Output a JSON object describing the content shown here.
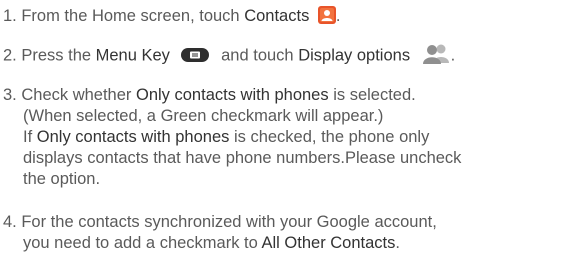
{
  "steps": [
    {
      "num": "1.",
      "pre": " From the Home screen, touch ",
      "bold": "Contacts",
      "post": ".",
      "icon": "contacts-icon"
    },
    {
      "num": "2.",
      "a": " Press the ",
      "b1": "Menu Key",
      "c": " and touch ",
      "b2": "Display options",
      "d": ".",
      "icons": [
        "menu-key-icon",
        "display-options-icon"
      ]
    },
    {
      "num": "3.",
      "l1a": " Check whether ",
      "l1b": "Only contacts with phones",
      "l1c": " is selected.",
      "l2": "(When selected, a Green checkmark will appear.)",
      "l3a": "If ",
      "l3b": "Only contacts with phones",
      "l3c": " is checked, the phone only",
      "l4": "displays contacts that have phone numbers.Please uncheck",
      "l5": "the option."
    },
    {
      "num": "4.",
      "l1": " For the contacts synchronized with your Google account,",
      "l2a": "you need to add a checkmark to ",
      "l2b": "All Other Contacts",
      "l2c": "."
    }
  ],
  "colors": {
    "text": "#5a5a5a",
    "emphasis": "#333333",
    "contacts_icon": "#e8542a",
    "checkmark": "#3aa63a"
  }
}
